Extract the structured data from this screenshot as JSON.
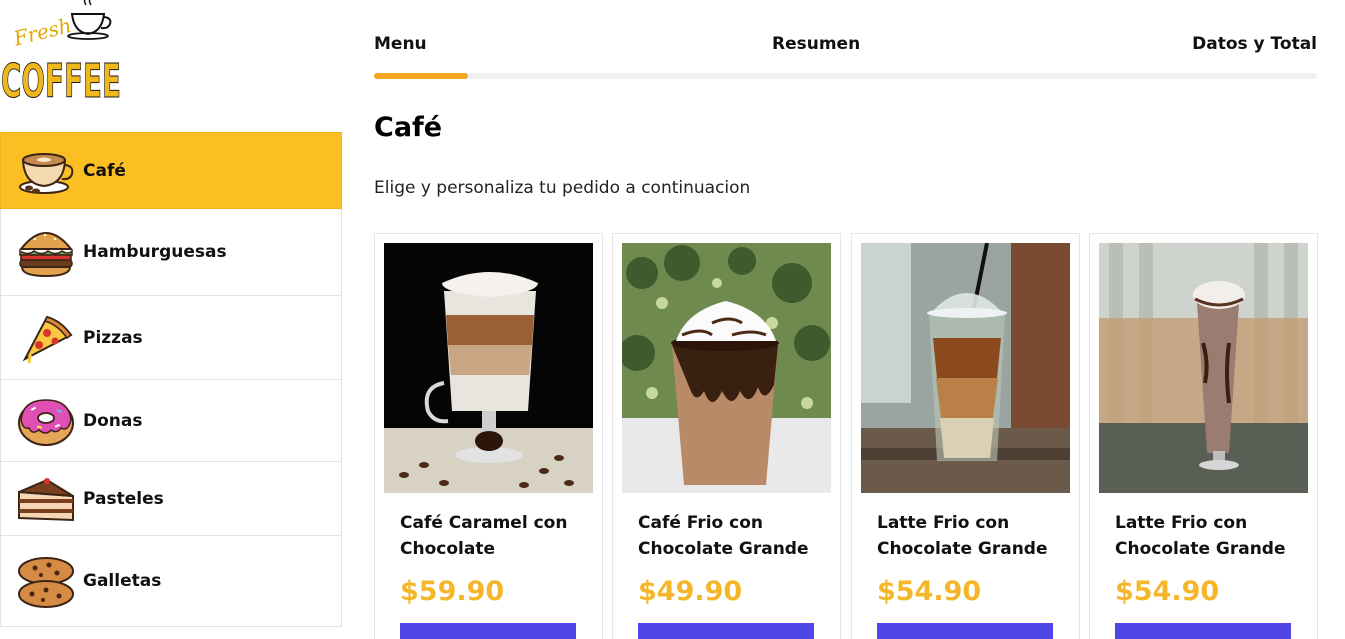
{
  "logo": {
    "line1": "Fresh",
    "line2": "COFFEE",
    "icon": "coffee-cup-icon"
  },
  "categories": [
    {
      "label": "Café",
      "icon": "coffee-cup-icon",
      "active": true
    },
    {
      "label": "Hamburguesas",
      "icon": "hamburger-icon",
      "active": false
    },
    {
      "label": "Pizzas",
      "icon": "pizza-slice-icon",
      "active": false
    },
    {
      "label": "Donas",
      "icon": "donut-icon",
      "active": false
    },
    {
      "label": "Pasteles",
      "icon": "cake-slice-icon",
      "active": false
    },
    {
      "label": "Galletas",
      "icon": "cookies-icon",
      "active": false
    }
  ],
  "steps": [
    {
      "label": "Menu"
    },
    {
      "label": "Resumen"
    },
    {
      "label": "Datos y Total"
    }
  ],
  "progress": {
    "fraction": 0.1,
    "color": "#f5a623"
  },
  "main": {
    "title": "Café",
    "subtitle": "Elige y personaliza tu pedido a continuacion"
  },
  "products": [
    {
      "name": "Café Caramel con Chocolate",
      "price": "$59.90"
    },
    {
      "name": "Café Frio con Chocolate Grande",
      "price": "$49.90"
    },
    {
      "name": "Latte Frio con Chocolate Grande",
      "price": "$54.90"
    },
    {
      "name": "Latte Frio con Chocolate Grande",
      "price": "$54.90"
    }
  ],
  "colors": {
    "accent": "#fbbf24",
    "price": "#f5b729",
    "button": "#4f46e5"
  }
}
